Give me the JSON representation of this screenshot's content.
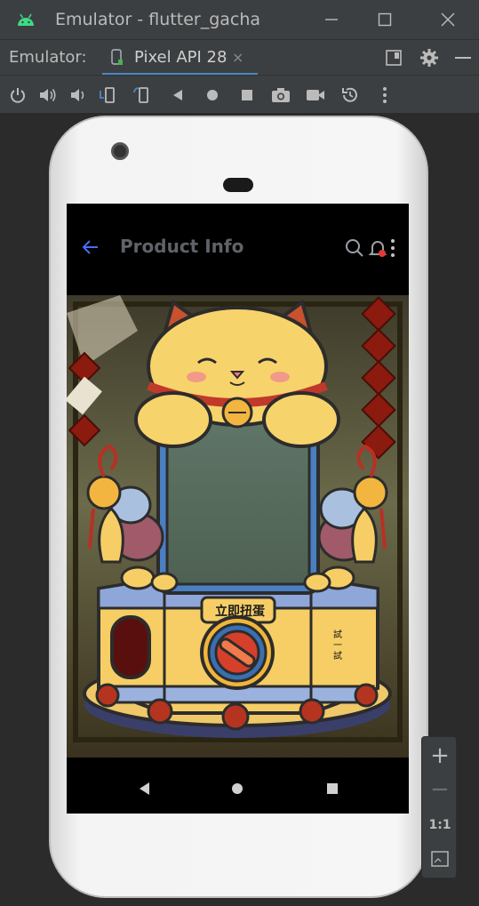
{
  "window": {
    "title": "Emulator - flutter_gacha",
    "controls": [
      "minimize",
      "maximize",
      "close"
    ]
  },
  "tabbar": {
    "label": "Emulator:",
    "tab_name": "Pixel API 28",
    "tab_close": "×"
  },
  "toolbar": {
    "buttons": [
      "power",
      "volume-up",
      "volume-down",
      "rotate-left",
      "rotate-right",
      "back",
      "home",
      "overview",
      "screenshot",
      "screen-record",
      "snapshot",
      "more"
    ]
  },
  "app": {
    "title": "Product Info",
    "machine_label": "立即扭蛋",
    "side_label": "試一試"
  },
  "side_panel": {
    "zoom_in": "+",
    "zoom_out": "−",
    "ratio": "1:1"
  },
  "colors": {
    "chrome": "#3c3f41",
    "accent": "#4a88c7",
    "cat_yellow": "#f7d36b",
    "badge_red": "#e53935"
  }
}
